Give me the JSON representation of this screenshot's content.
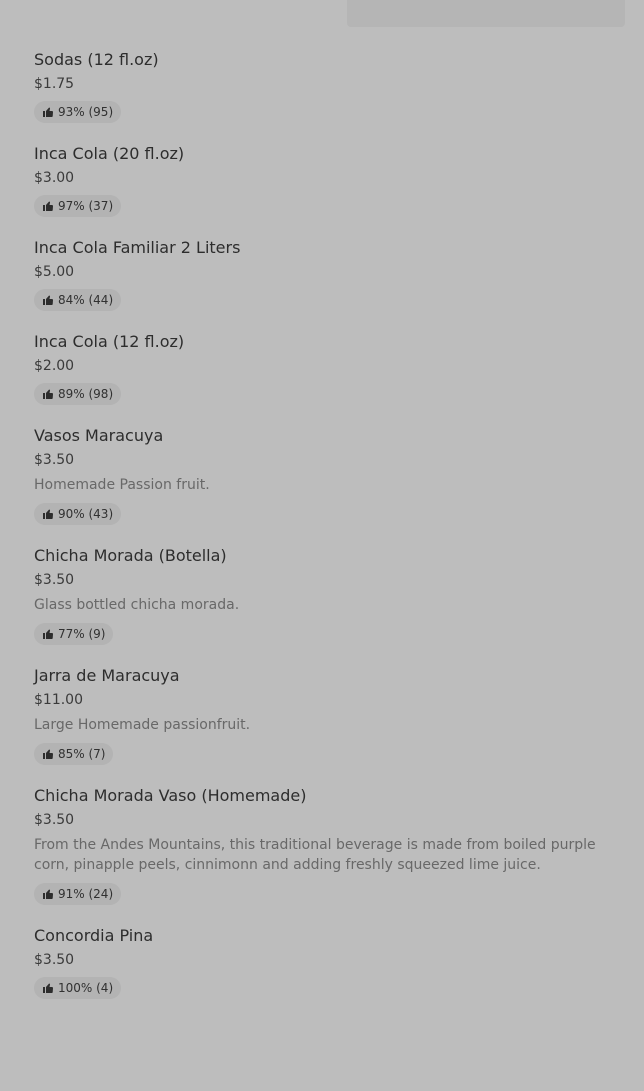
{
  "menu": {
    "items": [
      {
        "name": "Sodas (12 fl.oz)",
        "price": "$1.75",
        "description": "",
        "rating": "93% (95)"
      },
      {
        "name": "Inca Cola (20 fl.oz)",
        "price": "$3.00",
        "description": "",
        "rating": "97% (37)"
      },
      {
        "name": "Inca Cola Familiar 2 Liters",
        "price": "$5.00",
        "description": "",
        "rating": "84% (44)"
      },
      {
        "name": "Inca Cola (12 fl.oz)",
        "price": "$2.00",
        "description": "",
        "rating": "89% (98)"
      },
      {
        "name": "Vasos Maracuya",
        "price": "$3.50",
        "description": "Homemade Passion fruit.",
        "rating": "90% (43)"
      },
      {
        "name": "Chicha Morada (Botella)",
        "price": "$3.50",
        "description": "Glass bottled chicha morada.",
        "rating": "77% (9)"
      },
      {
        "name": "Jarra de Maracuya",
        "price": "$11.00",
        "description": "Large Homemade passionfruit.",
        "rating": "85% (7)"
      },
      {
        "name": "Chicha Morada Vaso (Homemade)",
        "price": "$3.50",
        "description": "From the Andes Mountains, this traditional beverage is made from boiled purple corn, pinapple peels, cinnimonn and adding freshly squeezed lime juice.",
        "rating": "91% (24)"
      },
      {
        "name": "Concordia Pina",
        "price": "$3.50",
        "description": "",
        "rating": "",
        "rating_partial": "100% (4)"
      }
    ]
  },
  "icons": {
    "rating_icon": "thumbs-up-icon"
  },
  "colors": {
    "background": "#bdbdbd",
    "badge": "#b3b3b3",
    "text": "#2d2d2d",
    "muted": "#686868"
  }
}
